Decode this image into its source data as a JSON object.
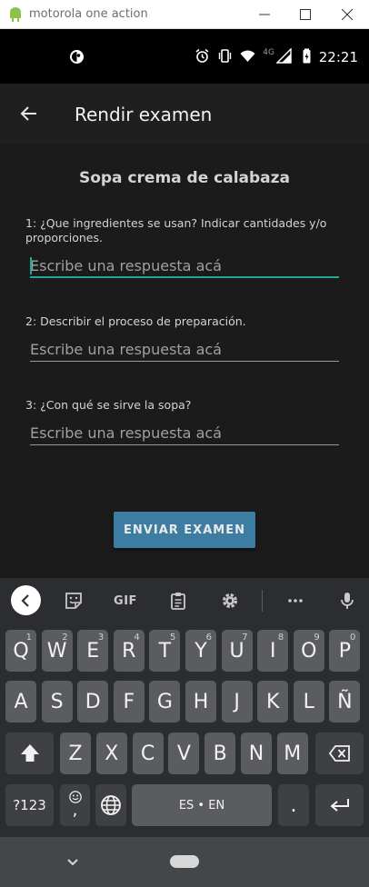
{
  "window": {
    "title": "motorola one action"
  },
  "status_bar": {
    "network": "4G",
    "time": "22:21",
    "icons": [
      "app-notification-icon",
      "alarm-icon",
      "vibrate-icon",
      "wifi-icon",
      "signal-icon",
      "battery-icon"
    ]
  },
  "app_bar": {
    "title": "Rendir examen"
  },
  "exam": {
    "recipe_title": "Sopa crema de calabaza",
    "questions": [
      {
        "label": "1: ¿Que ingredientes se usan? Indicar cantidades y/o proporciones.",
        "placeholder": "Escribe una respuesta acá"
      },
      {
        "label": "2: Describir el proceso de preparación.",
        "placeholder": "Escribe una respuesta acá"
      },
      {
        "label": "3: ¿Con qué se sirve la sopa?",
        "placeholder": "Escribe una respuesta acá"
      }
    ],
    "submit_label": "ENVIAR EXAMEN"
  },
  "keyboard": {
    "toolbar": {
      "gif_label": "GIF"
    },
    "row1": [
      {
        "key": "Q",
        "hint": "1"
      },
      {
        "key": "W",
        "hint": "2"
      },
      {
        "key": "E",
        "hint": "3"
      },
      {
        "key": "R",
        "hint": "4"
      },
      {
        "key": "T",
        "hint": "5"
      },
      {
        "key": "Y",
        "hint": "6"
      },
      {
        "key": "U",
        "hint": "7"
      },
      {
        "key": "I",
        "hint": "8"
      },
      {
        "key": "O",
        "hint": "9"
      },
      {
        "key": "P",
        "hint": "0"
      }
    ],
    "row2": [
      "A",
      "S",
      "D",
      "F",
      "G",
      "H",
      "J",
      "K",
      "L",
      "Ñ"
    ],
    "row3": [
      "Z",
      "X",
      "C",
      "V",
      "B",
      "N",
      "M"
    ],
    "symbols_label": "?123",
    "comma_label": ",",
    "space_label": "ES • EN",
    "period_label": "."
  },
  "colors": {
    "accent": "#26a69a",
    "button": "#3d7da1",
    "background": "#1b1b1b",
    "key": "#5a5c60",
    "keyboard_bg": "#2b2d30"
  }
}
